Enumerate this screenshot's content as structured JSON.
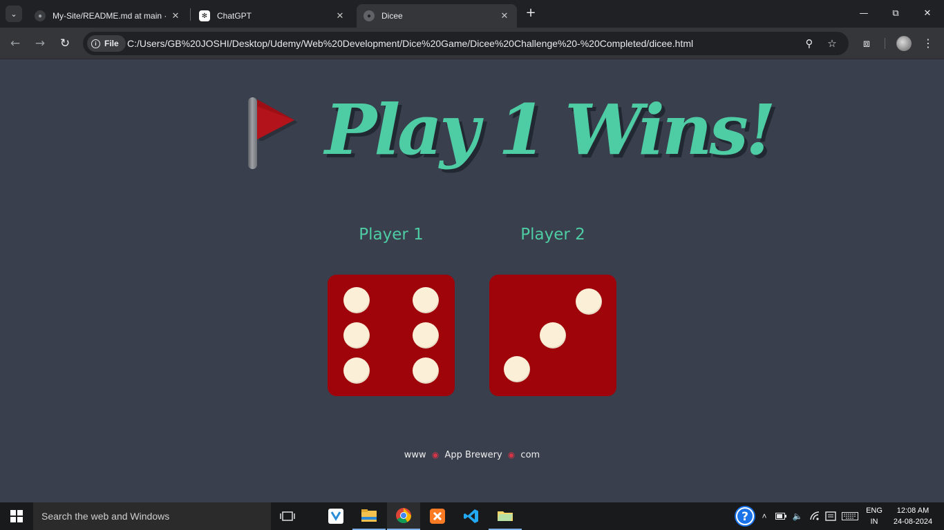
{
  "browser": {
    "tabs": [
      {
        "title": "My-Site/README.md at main · ",
        "favicon": "github-icon"
      },
      {
        "title": "ChatGPT",
        "favicon": "chatgpt-icon"
      },
      {
        "title": "Dicee",
        "favicon": "globe-icon",
        "active": true
      }
    ],
    "address": {
      "chip_label": "File",
      "url": "C:/Users/GB%20JOSHI/Desktop/Udemy/Web%20Development/Dice%20Game/Dicee%20Challenge%20-%20Completed/dicee.html"
    }
  },
  "page": {
    "headline": "Play 1 Wins!",
    "players": [
      {
        "label": "Player 1",
        "die_value": 6
      },
      {
        "label": "Player 2",
        "die_value": 3
      }
    ],
    "footer": {
      "www": "www",
      "brand": "App Brewery",
      "com": "com"
    },
    "colors": {
      "background": "#393f4d",
      "accent": "#4ecca3",
      "die": "#a0040b",
      "pip": "#fcefd7",
      "flag": "#b3131b"
    }
  },
  "taskbar": {
    "search_placeholder": "Search the web and Windows",
    "apps": [
      "task-view-icon",
      "tutanota-icon",
      "file-explorer-icon",
      "chrome-icon",
      "xampp-icon",
      "vscode-icon",
      "folder-icon"
    ],
    "language": {
      "line1": "ENG",
      "line2": "IN"
    },
    "time": "12:08 AM",
    "date": "24-08-2024"
  }
}
